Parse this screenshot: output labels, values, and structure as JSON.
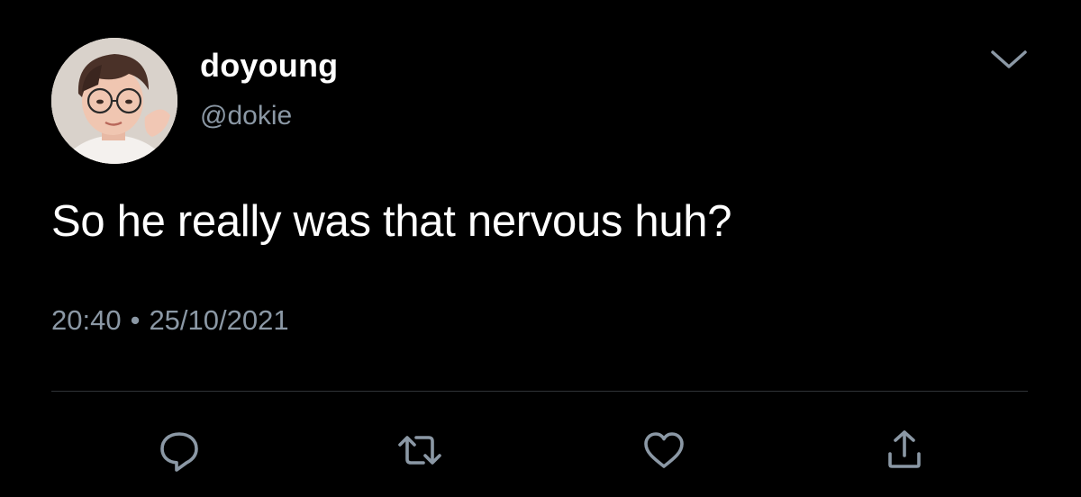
{
  "tweet": {
    "display_name": "doyoung",
    "handle": "@dokie",
    "text": "So he really was that nervous huh?",
    "time": "20:40",
    "separator": "•",
    "date": "25/10/2021"
  },
  "icons": {
    "menu": "chevron-down-icon",
    "reply": "reply-icon",
    "retweet": "retweet-icon",
    "like": "heart-icon",
    "share": "share-icon"
  },
  "colors": {
    "background": "#000000",
    "primary_text": "#ffffff",
    "secondary_text": "#8b98a5",
    "divider": "#2f3336",
    "icon": "#8b98a5"
  }
}
